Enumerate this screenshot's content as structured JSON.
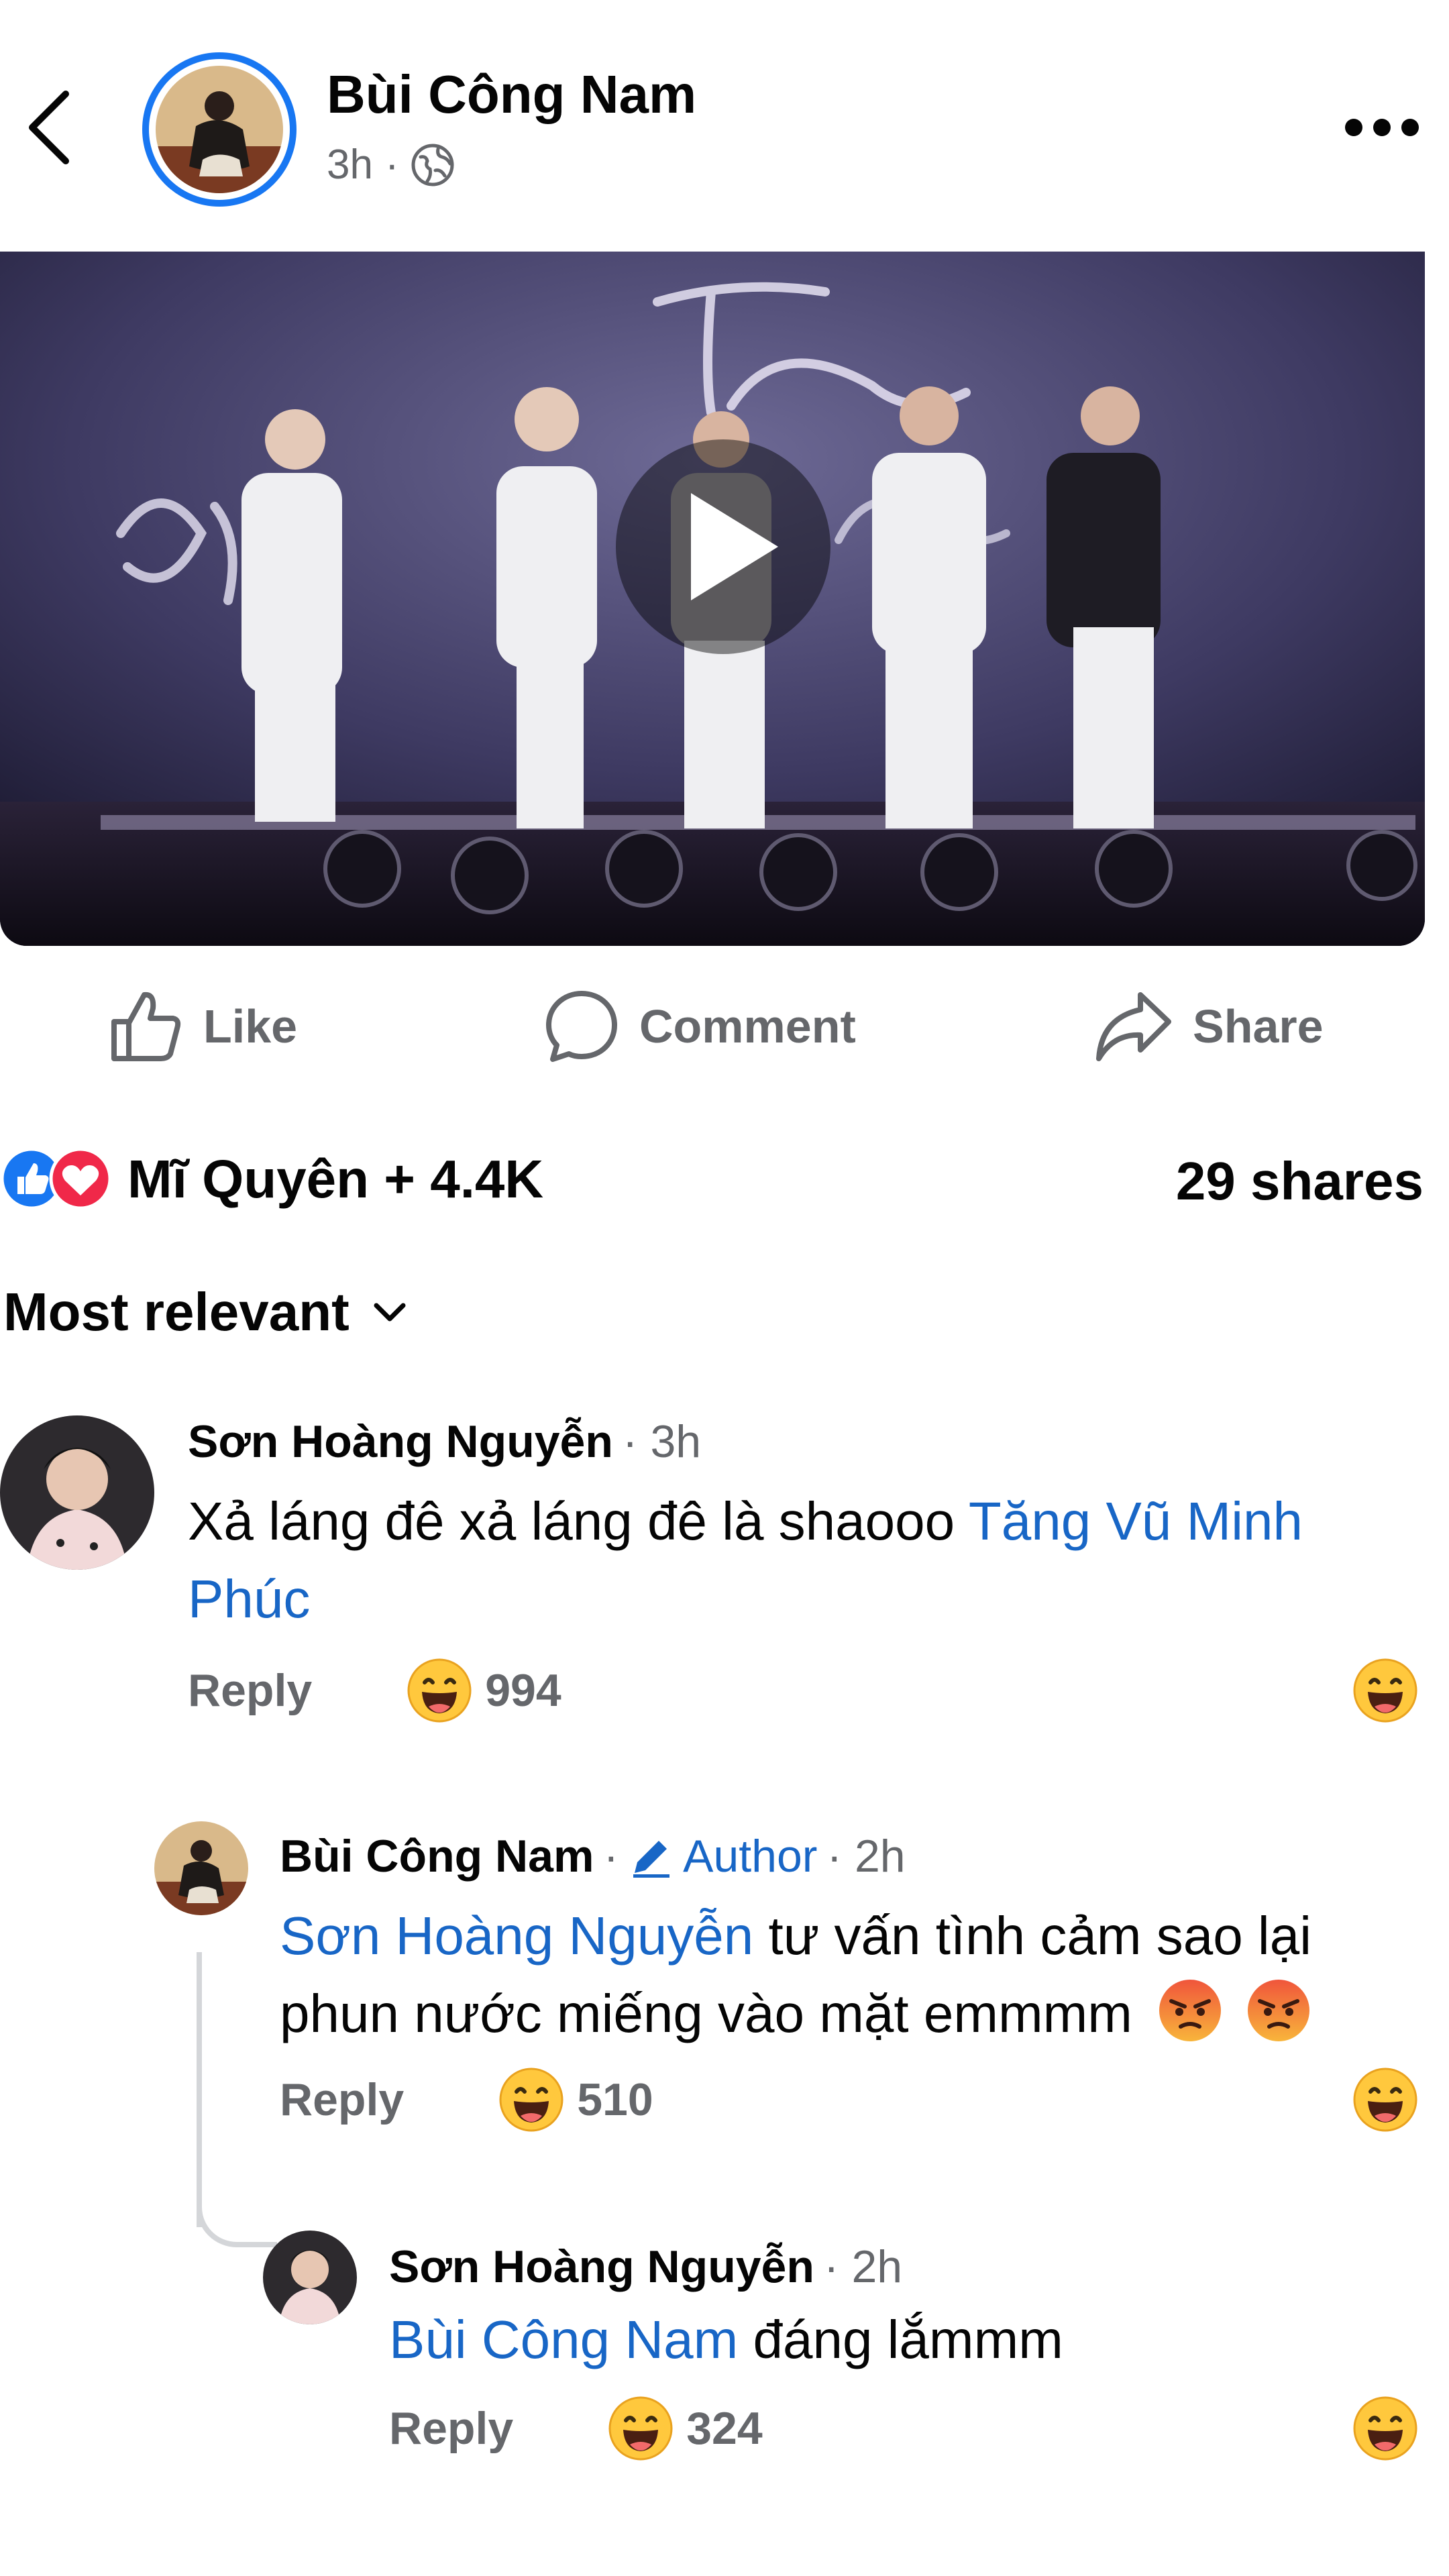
{
  "header": {
    "author_name": "Bùi Công Nam",
    "time": "3h",
    "separator": "·",
    "audience_icon": "globe-icon"
  },
  "actions": {
    "like": "Like",
    "comment": "Comment",
    "share": "Share"
  },
  "stats": {
    "reactors": "Mĩ Quyên + 4.4K",
    "shares": "29 shares",
    "reaction_icons": [
      "like-icon",
      "love-icon"
    ]
  },
  "sort": {
    "label": "Most relevant"
  },
  "comments": [
    {
      "name": "Sơn Hoàng Nguyễn",
      "time": "· 3h",
      "text": "Xả láng đê xả láng đê là shaooo ",
      "mention": "Tăng Vũ Minh Phúc",
      "reply": "Reply",
      "reaction_count": "994"
    },
    {
      "name": "Bùi Công Nam",
      "badge": "Author",
      "time": "· 2h",
      "mention": "Sơn Hoàng Nguyễn",
      "text": " tư vấn tình cảm sao lại phun nước miếng vào mặt emmmm",
      "reply": "Reply",
      "reaction_count": "510"
    },
    {
      "name": "Sơn Hoàng Nguyễn",
      "time": "· 2h",
      "mention": "Bùi Công Nam",
      "text": " đáng lắmmm",
      "reply": "Reply",
      "reaction_count": "324"
    }
  ],
  "colors": {
    "accent": "#1877F2",
    "mention": "#1866C6",
    "secondary_text": "#65676B",
    "love": "#F02849"
  }
}
